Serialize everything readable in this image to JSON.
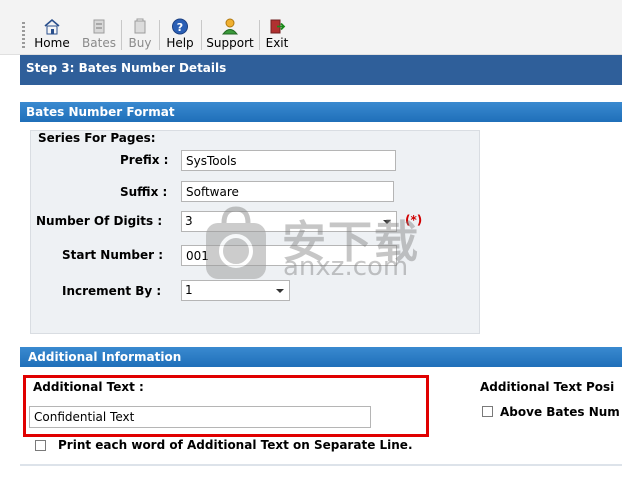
{
  "toolbar": {
    "home": "Home",
    "bates": "Bates",
    "buy": "Buy",
    "help": "Help",
    "support": "Support",
    "exit": "Exit"
  },
  "step_title": "Step 3: Bates Number Details",
  "format": {
    "header": "Bates Number Format",
    "series_label": "Series For Pages:",
    "prefix_label": "Prefix :",
    "prefix_value": "SysTools",
    "suffix_label": "Suffix :",
    "suffix_value": "Software",
    "digits_label": "Number Of Digits :",
    "digits_value": "3",
    "required_mark": "(*)",
    "start_label": "Start Number :",
    "start_value": "001",
    "increment_label": "Increment By :",
    "increment_value": "1"
  },
  "additional": {
    "header": "Additional Information",
    "text_label": "Additional Text :",
    "text_value": "Confidential Text",
    "position_label": "Additional Text Posi",
    "above_label": "Above Bates Num",
    "separate_line_label": "Print each word of Additional Text on Separate Line."
  },
  "watermark": {
    "cn": "安下载",
    "url": "anxz.com"
  },
  "colors": {
    "header_dark": "#2f5f9a",
    "header_blue": "#1f6fb9",
    "highlight_red": "#e00000",
    "required_red": "#d00000"
  }
}
